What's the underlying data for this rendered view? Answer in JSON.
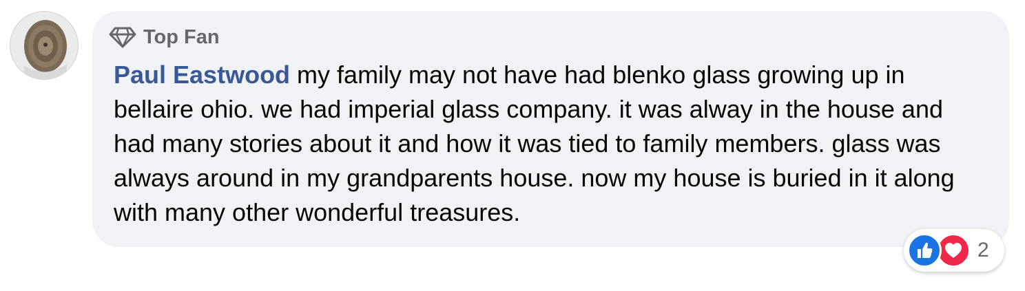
{
  "comment": {
    "avatar_icon": "avatar-photo",
    "badge": {
      "icon": "diamond-icon",
      "label": "Top Fan"
    },
    "author": "Paul Eastwood",
    "text": " my family may not have had blenko glass growing up in bellaire ohio. we had imperial glass company. it was alway in the house and had many stories about it and how it was tied to family members. glass was always around in my grandparents house. now my house is buried in it along with many other wonderful treasures.",
    "reactions": {
      "icons": [
        "like-icon",
        "love-icon"
      ],
      "count": "2"
    }
  },
  "colors": {
    "bubble_bg": "#f0f2f5",
    "author_link": "#385898",
    "like_blue": "#1b74e4",
    "love_red": "#f02849",
    "muted_text": "#65676b"
  }
}
